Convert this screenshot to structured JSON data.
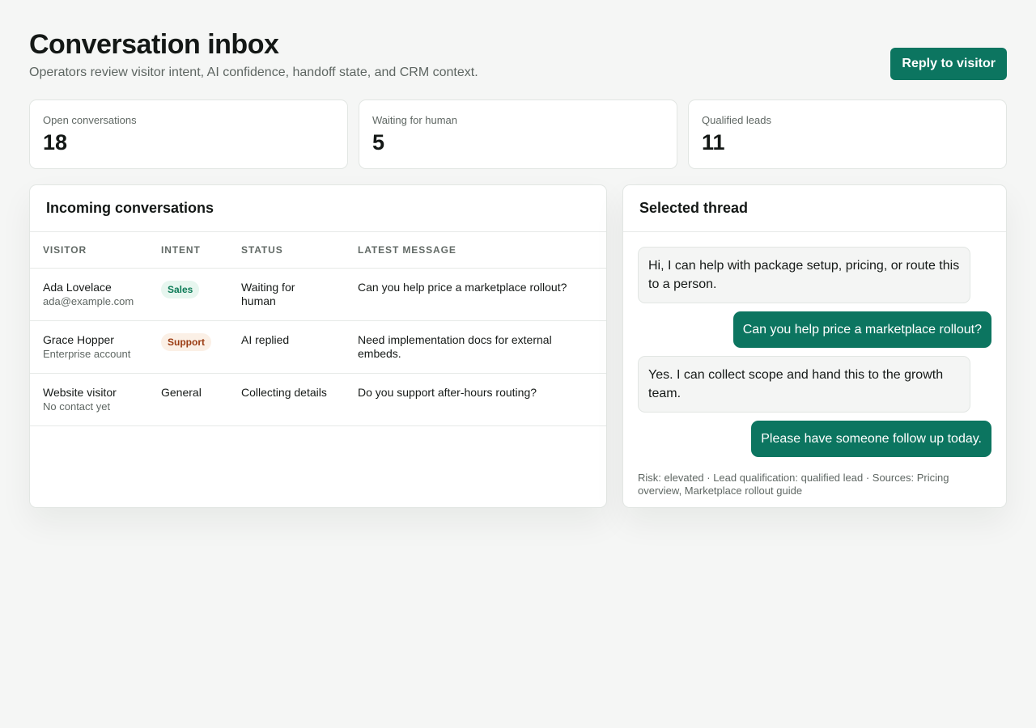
{
  "header": {
    "title": "Conversation inbox",
    "subtitle": "Operators review visitor intent, AI confidence, handoff state, and CRM context.",
    "reply_button": "Reply to visitor"
  },
  "stats": [
    {
      "label": "Open conversations",
      "value": "18"
    },
    {
      "label": "Waiting for human",
      "value": "5"
    },
    {
      "label": "Qualified leads",
      "value": "11"
    }
  ],
  "conversations": {
    "title": "Incoming conversations",
    "columns": [
      "VISITOR",
      "INTENT",
      "STATUS",
      "LATEST MESSAGE"
    ],
    "rows": [
      {
        "visitor": "Ada Lovelace",
        "detail": "ada@example.com",
        "intent": "Sales",
        "status": "Waiting for human",
        "message": "Can you help price a marketplace rollout?"
      },
      {
        "visitor": "Grace Hopper",
        "detail": "Enterprise account",
        "intent": "Support",
        "status": "AI replied",
        "message": "Need implementation docs for external embeds."
      },
      {
        "visitor": "Website visitor",
        "detail": "No contact yet",
        "intent": "General",
        "status": "Collecting details",
        "message": "Do you support after-hours routing?"
      }
    ]
  },
  "thread": {
    "title": "Selected thread",
    "messages": [
      {
        "from": "ai",
        "text": "Hi, I can help with package setup, pricing, or route this to a person."
      },
      {
        "from": "visitor",
        "text": "Can you help price a marketplace rollout?"
      },
      {
        "from": "ai",
        "text": "Yes. I can collect scope and hand this to the growth team."
      },
      {
        "from": "visitor",
        "text": "Please have someone follow up today."
      }
    ],
    "meta": "Risk: elevated · Lead qualification: qualified lead · Sources: Pricing overview, Marketplace rollout guide"
  },
  "colors": {
    "accent": "#0c7560",
    "sales_badge_bg": "#e7f6ef",
    "sales_badge_text": "#0c7a56",
    "support_badge_bg": "#fbf0e6",
    "support_badge_text": "#9a3b12"
  }
}
